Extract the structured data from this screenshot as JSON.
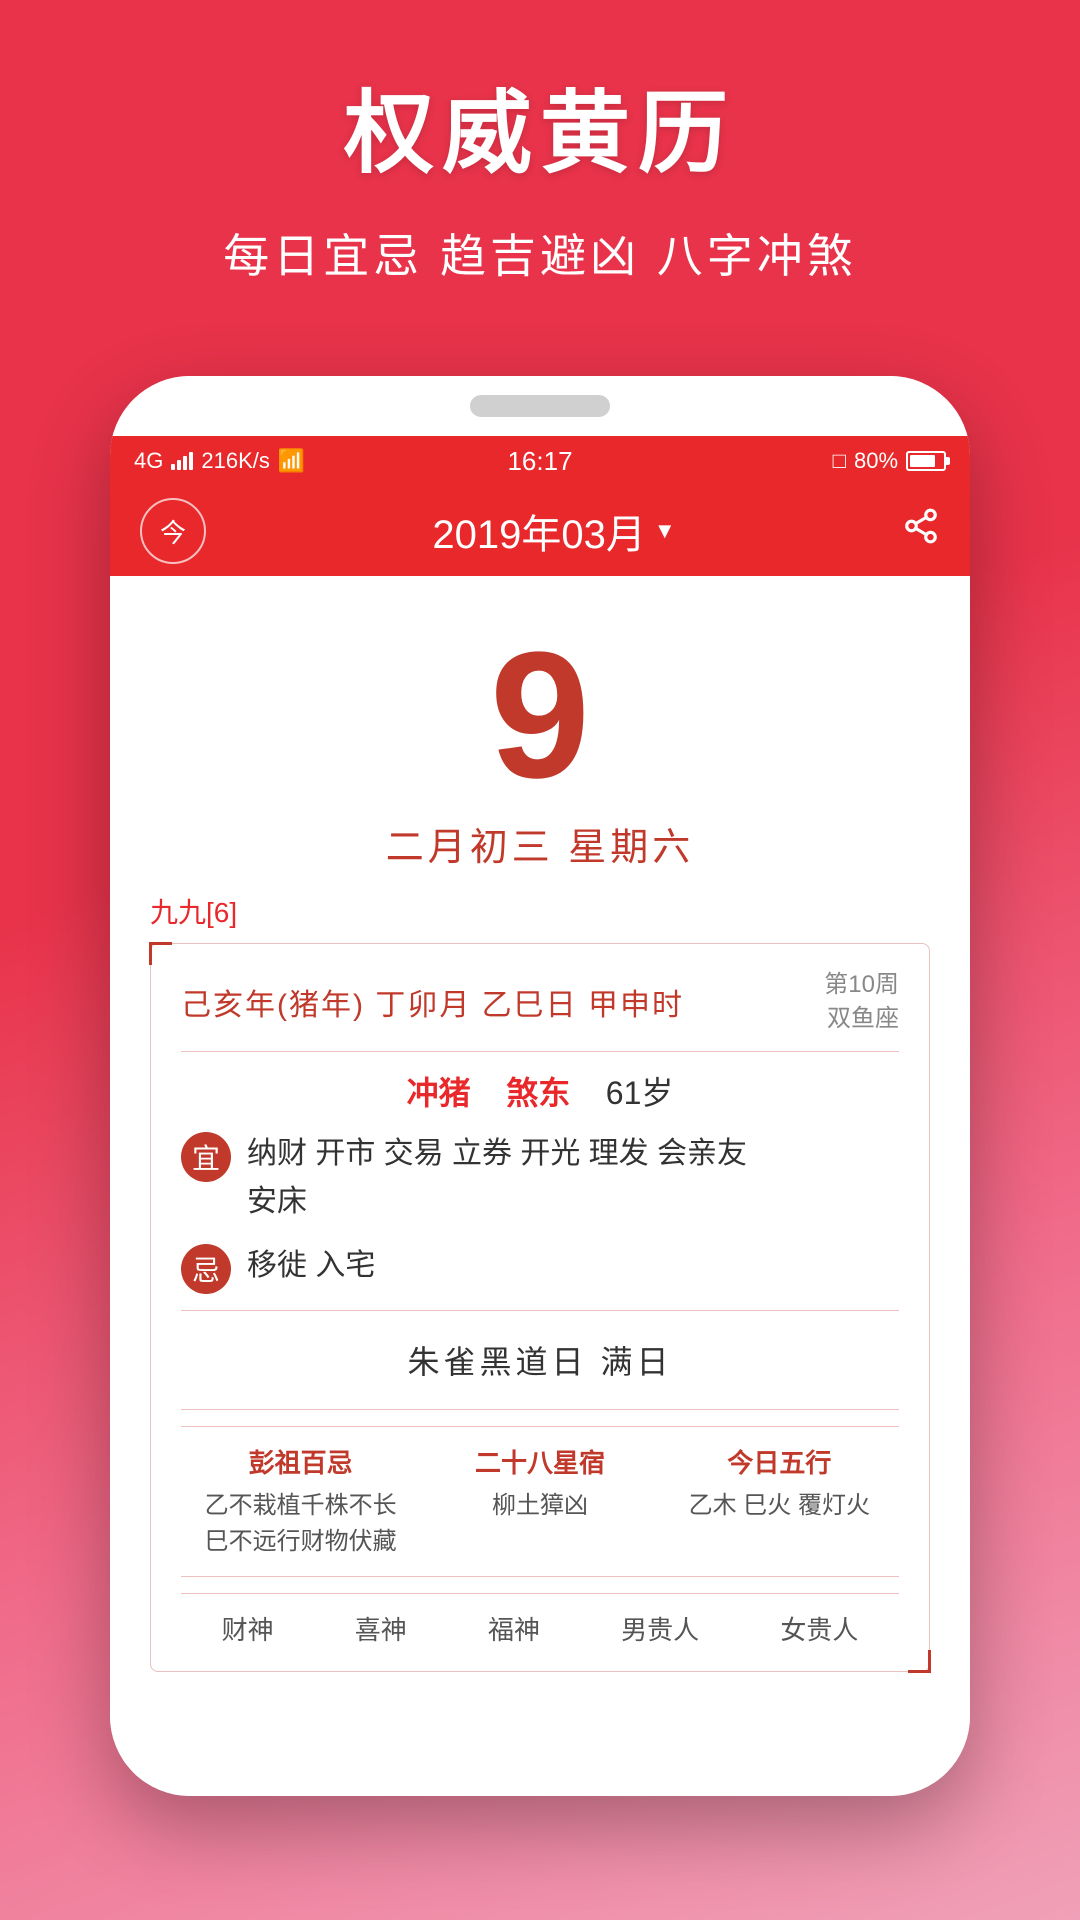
{
  "app": {
    "main_title": "权威黄历",
    "subtitle": "每日宜忌 趋吉避凶 八字冲煞"
  },
  "status_bar": {
    "signal": "4G",
    "speed": "216K/s",
    "wifi": "WiFi",
    "time": "16:17",
    "alarm": "🔔",
    "battery_percent": "80%"
  },
  "header": {
    "today_label": "今",
    "month_title": "2019年03月",
    "share_label": "⤻"
  },
  "calendar": {
    "big_date": "9",
    "lunar_date": "二月初三  星期六",
    "nine_nine": "九九[6]",
    "ganzhi": "己亥年(猪年) 丁卯月 乙巳日 甲申时",
    "week_label": "第10周",
    "zodiac": "双鱼座",
    "chong": "冲猪",
    "sha": "煞东",
    "age": "61岁",
    "yi_label": "宜",
    "yi_text": "纳财 开市 交易 立券 开光 理发 会亲友\n安床",
    "ji_label": "忌",
    "ji_text": "移徙 入宅",
    "special_day": "朱雀黑道日  满日",
    "pengzu_title": "彭祖百忌",
    "pengzu_text": "乙不栽植千株不长\n巳不远行财物伏藏",
    "stars_title": "二十八星宿",
    "stars_text": "柳土獐凶",
    "wuxing_title": "今日五行",
    "wuxing_text": "乙木 巳火 覆灯火",
    "footer_items": [
      "财神",
      "喜神",
      "福神",
      "男贵人",
      "女贵人"
    ]
  },
  "colors": {
    "primary_red": "#e8282a",
    "dark_red": "#c0392b",
    "bg_gradient_start": "#e8334a",
    "bg_gradient_end": "#f0a0b8"
  }
}
